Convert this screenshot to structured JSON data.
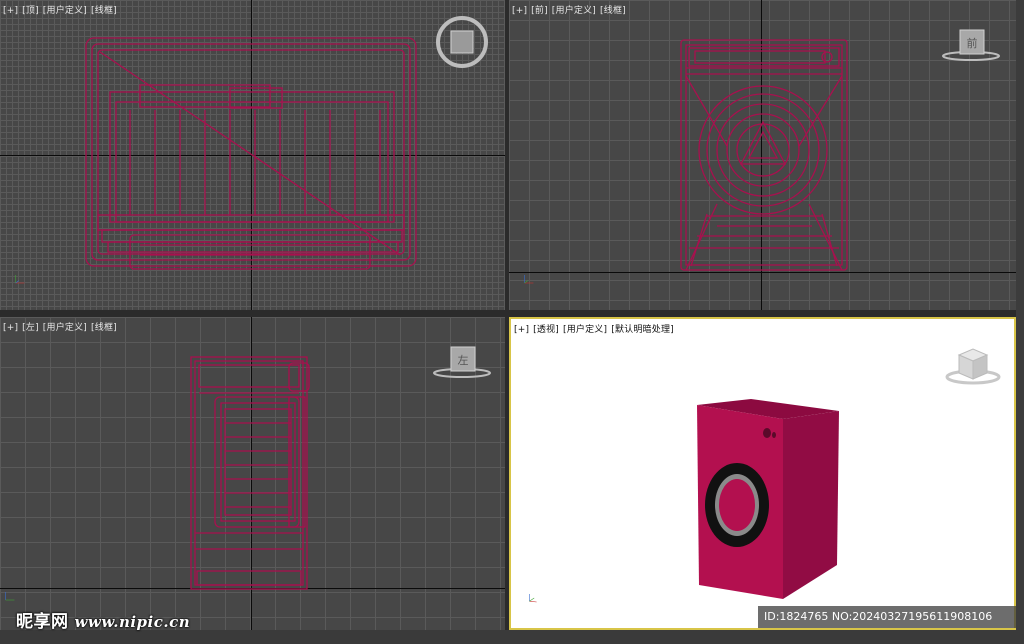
{
  "viewports": {
    "top": {
      "labels": [
        "[+]",
        "[顶]",
        "[用户定义]",
        "[线框]"
      ]
    },
    "front": {
      "labels": [
        "[+]",
        "[前]",
        "[用户定义]",
        "[线框]"
      ],
      "cube_face": "前"
    },
    "left": {
      "labels": [
        "[+]",
        "[左]",
        "[用户定义]",
        "[线框]"
      ],
      "cube_face": "左"
    },
    "perspective": {
      "labels": [
        "[+]",
        "[透视]",
        "[用户定义]",
        "[默认明暗处理]"
      ]
    }
  },
  "model_color": "#a8104e",
  "watermark": {
    "brand": "昵享网",
    "url": "www.nipic.cn"
  },
  "image_id": "ID:1824765 NO:20240327195611908106"
}
